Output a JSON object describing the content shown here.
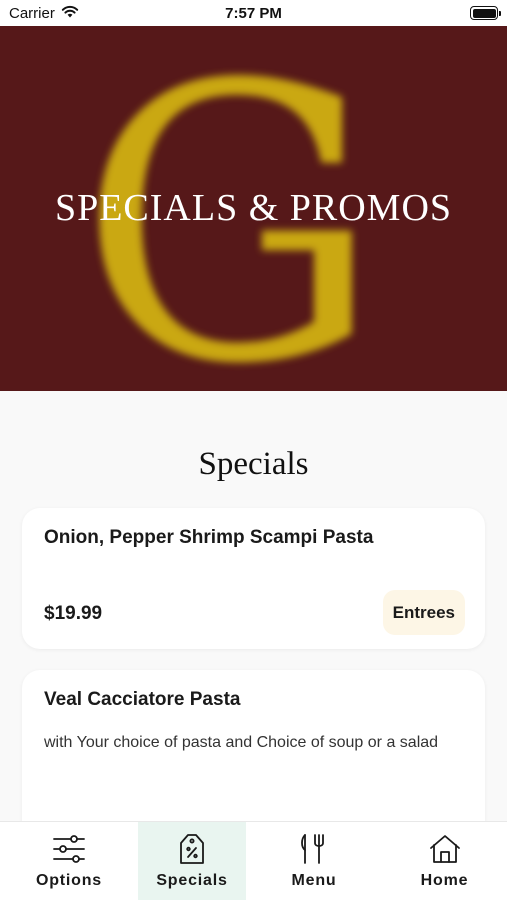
{
  "status_bar": {
    "carrier": "Carrier",
    "time": "7:57 PM",
    "icons": [
      "wifi-icon",
      "battery-icon"
    ]
  },
  "hero": {
    "logo_letter": "G",
    "title": "SPECIALS & PROMOS",
    "background_color": "#561819",
    "logo_color": "#cfae12"
  },
  "section": {
    "title": "Specials"
  },
  "specials": [
    {
      "title": "Onion, Pepper Shrimp Scampi Pasta",
      "description": "",
      "price": "$19.99",
      "category": "Entrees"
    },
    {
      "title": "Veal Cacciatore Pasta",
      "description": "with Your choice of pasta and Choice of soup or a salad",
      "price": "",
      "category": ""
    }
  ],
  "tab_bar": {
    "active_tab": "Specials",
    "active_color": "#e9f5f0",
    "tabs": [
      {
        "label": "Options",
        "icon": "sliders-icon"
      },
      {
        "label": "Specials",
        "icon": "price-tag-icon"
      },
      {
        "label": "Menu",
        "icon": "fork-knife-icon"
      },
      {
        "label": "Home",
        "icon": "home-icon"
      }
    ]
  }
}
